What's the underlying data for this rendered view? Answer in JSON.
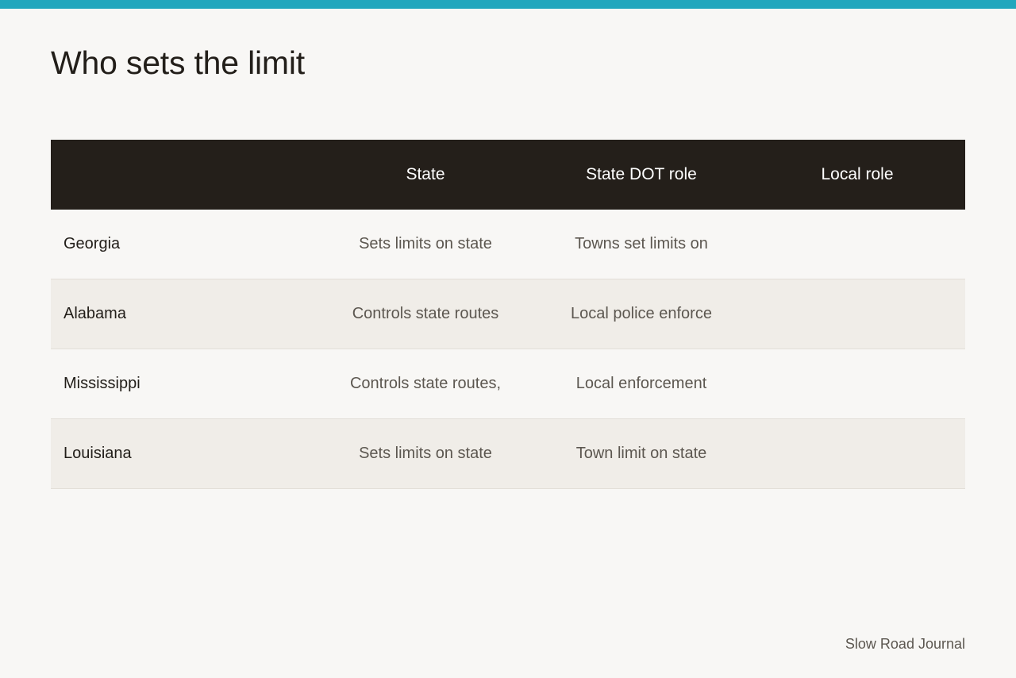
{
  "title": "Who sets the limit",
  "table": {
    "columns": [
      "",
      "State",
      "State DOT role",
      "Local role"
    ],
    "rows": [
      {
        "name": "Georgia",
        "state": "Sets limits on state",
        "dot_role": "Towns set limits on",
        "local_role": ""
      },
      {
        "name": "Alabama",
        "state": "Controls state routes",
        "dot_role": "Local police enforce",
        "local_role": ""
      },
      {
        "name": "Mississippi",
        "state": "Controls state routes,",
        "dot_role": "Local enforcement",
        "local_role": ""
      },
      {
        "name": "Louisiana",
        "state": "Sets limits on state",
        "dot_role": "Town limit on state",
        "local_role": ""
      }
    ]
  },
  "footer": "Slow Road Journal",
  "colors": {
    "accent": "#22a7bd",
    "header_bg": "#241f1a",
    "row_alt_bg": "#f0ede8",
    "page_bg": "#f8f7f5"
  }
}
